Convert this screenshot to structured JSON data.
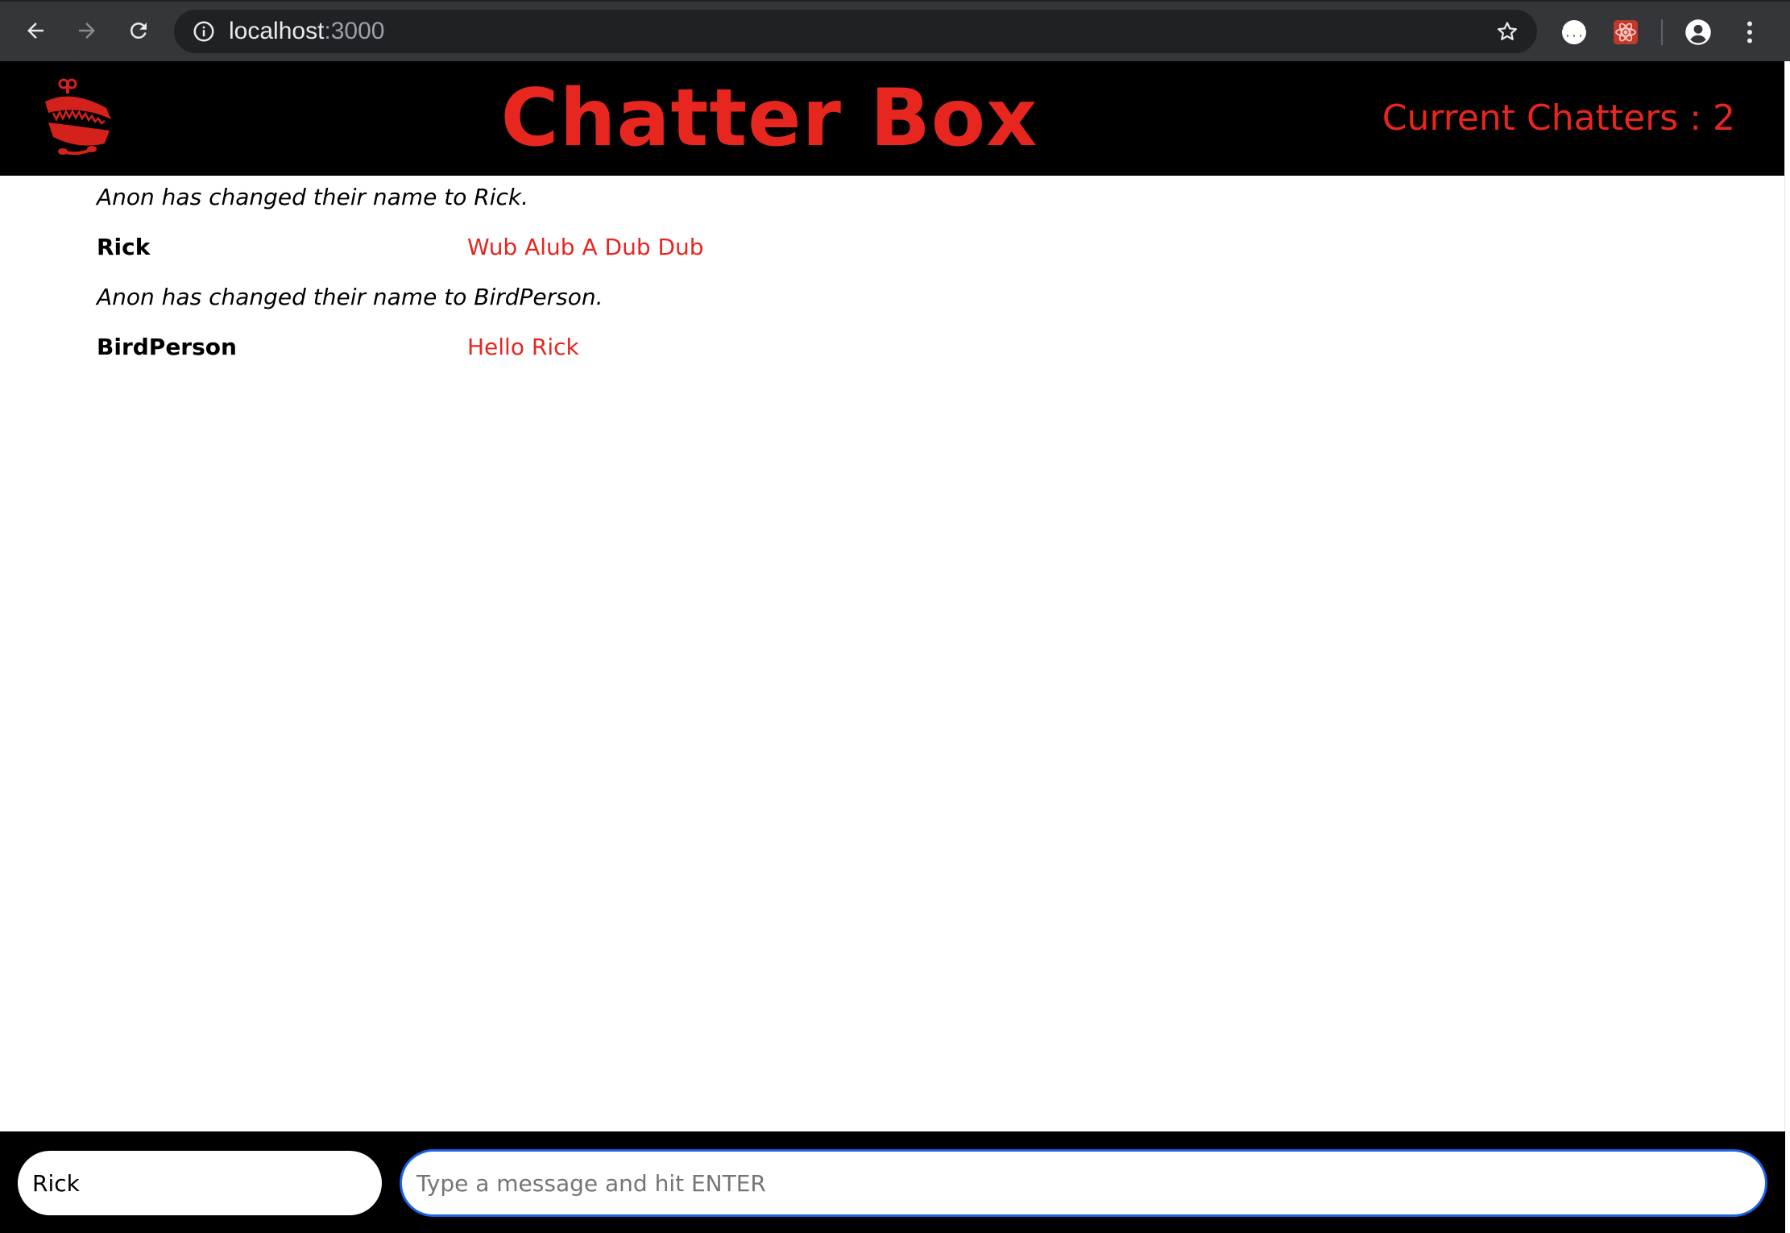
{
  "browser": {
    "url_host": "localhost",
    "url_port": ":3000",
    "back_icon": "arrow-left-icon",
    "forward_icon": "arrow-right-icon",
    "reload_icon": "reload-icon",
    "info_icon": "info-icon",
    "bookmark_icon": "star-icon",
    "extension_icons": [
      "json-viewer-icon",
      "react-devtools-icon"
    ],
    "profile_icon": "account-icon",
    "menu_icon": "kebab-menu-icon"
  },
  "header": {
    "logo_icon": "chattering-teeth-icon",
    "title": "Chatter Box",
    "chatter_count": "Current Chatters : 2",
    "accent_color": "#e6261f",
    "background_color": "#000000"
  },
  "messages": [
    {
      "type": "system",
      "text": "Anon has changed their name to Rick."
    },
    {
      "type": "chat",
      "user": "Rick",
      "text": "Wub Alub A Dub Dub"
    },
    {
      "type": "system",
      "text": "Anon has changed their name to BirdPerson."
    },
    {
      "type": "chat",
      "user": "BirdPerson",
      "text": "Hello Rick"
    }
  ],
  "footer": {
    "name_value": "Rick",
    "message_placeholder": "Type a message and hit ENTER",
    "focus_ring_color": "#1a62e6"
  }
}
